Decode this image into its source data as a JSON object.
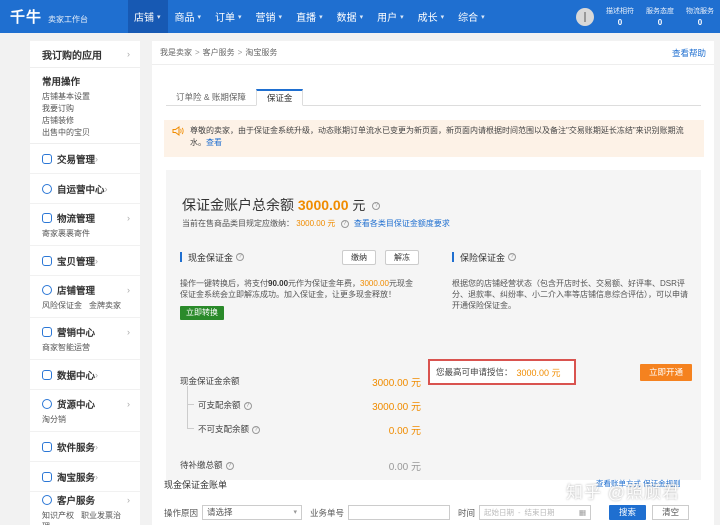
{
  "app": {
    "logo": "千牛",
    "logo_sub": "卖家工作台"
  },
  "nav": {
    "items": [
      "店铺",
      "商品",
      "订单",
      "营销",
      "直播",
      "数据",
      "用户",
      "成长",
      "综合"
    ],
    "active_index": 0
  },
  "top_stats": [
    {
      "label": "描述相符",
      "value": "0"
    },
    {
      "label": "服务态度",
      "value": "0"
    },
    {
      "label": "物流服务",
      "value": "0"
    }
  ],
  "sidebar": {
    "title": "我订购的应用",
    "common_title": "常用操作",
    "common_links": [
      [
        "店铺基本设置",
        "我要订购"
      ],
      [
        "店铺装修",
        "出售中的宝贝"
      ]
    ],
    "items": [
      {
        "label": "交易管理",
        "subs": []
      },
      {
        "label": "自运营中心",
        "subs": []
      },
      {
        "label": "物流管理",
        "subs": [
          "寄家裹裹寄件"
        ]
      },
      {
        "label": "宝贝管理",
        "subs": []
      },
      {
        "label": "店铺管理",
        "subs": [
          "风险保证金",
          "金牌卖家"
        ]
      },
      {
        "label": "营销中心",
        "subs": [
          "商家智能运营"
        ]
      },
      {
        "label": "数据中心",
        "subs": []
      },
      {
        "label": "货源中心",
        "subs": [
          "淘分销"
        ]
      },
      {
        "label": "软件服务",
        "subs": []
      },
      {
        "label": "淘宝服务",
        "subs": []
      },
      {
        "label": "客户服务",
        "subs": [
          "知识产权",
          "职业发票治理"
        ]
      }
    ]
  },
  "breadcrumb": [
    "我是卖家",
    "客户服务",
    "淘宝服务"
  ],
  "help_link": "查看帮助",
  "tabs": [
    "订单险 & 账期保障",
    "保证金"
  ],
  "active_tab": 1,
  "notice": {
    "text": "尊敬的卖家，由于保证金系统升级，动态账期订单流水已变更为新页面，新页面内请根据时间范围以及备注\"交易账期延长冻结\"来识别账期流水。",
    "link": "查看"
  },
  "account": {
    "total_label": "保证金账户总余额",
    "total_amount": "3000.00",
    "total_unit": "元",
    "current_label": "当前在售商品类目规定应缴纳：",
    "current_amount": "3000.00 元",
    "current_link": "查看各类目保证金额度要求"
  },
  "cash": {
    "title": "现金保证金",
    "btn_pay": "缴纳",
    "btn_release": "解冻",
    "desc_pre": "操作一键转换后，将支付",
    "desc_fee": "90.00",
    "desc_mid": "元作为保证金年费，",
    "desc_amt": "3000.00",
    "desc_post": "元现金保证金系统会立即解冻成功。加入保证金，让更多现金释放！",
    "btn_convert": "立即转换",
    "rows": [
      {
        "label": "现金保证金余额",
        "value": "3000.00 元"
      },
      {
        "label": "可支配余额",
        "value": "3000.00 元"
      },
      {
        "label": "不可支配余额",
        "value": "0.00 元"
      },
      {
        "label": "待补缴总额",
        "value": "0.00 元"
      }
    ]
  },
  "insurance": {
    "title": "保险保证金",
    "desc": "根据您的店铺经营状态（包含开店时长、交易额、好评率、DSR评分、退款率、纠纷率、小二介入率等店铺信息综合评估），可以申请开通保险保证金。",
    "quota_label": "您最高可申请授信：",
    "quota_amount": "3000.00 元",
    "btn_open": "立即开通"
  },
  "bill": {
    "title": "现金保证金账单",
    "links": "查看账单方式   保证金规则",
    "filter_reason_label": "操作原因",
    "filter_reason_value": "请选择",
    "filter_no_label": "业务单号",
    "filter_time_label": "时间",
    "start_placeholder": "起始日期",
    "end_placeholder": "结束日期",
    "btn_search": "搜索",
    "btn_clear": "清空"
  },
  "watermark": "知乎 @照顾君",
  "colors": {
    "nav_blue": "#1f6fd0",
    "orange": "#f08c00",
    "green": "#2a8a2a",
    "red_box": "#d9534f"
  }
}
